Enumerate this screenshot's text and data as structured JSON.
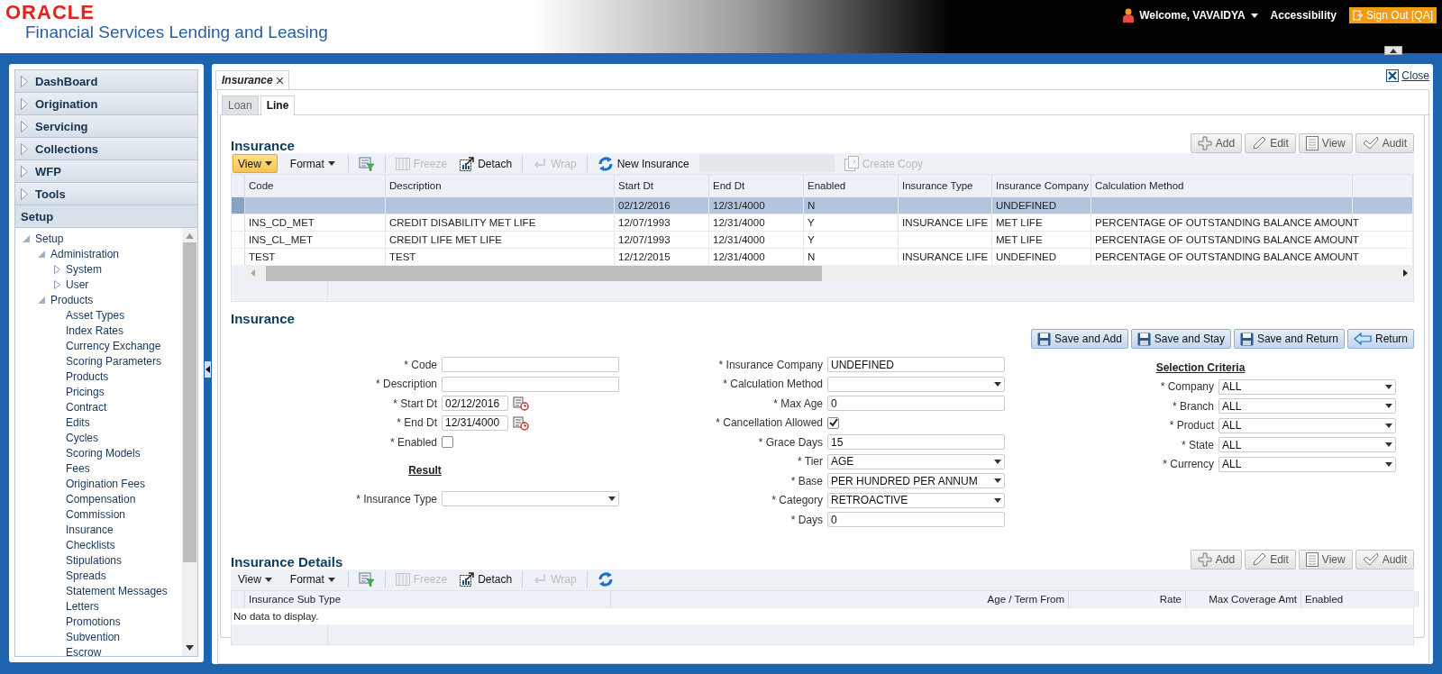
{
  "header": {
    "logo": "ORACLE",
    "product": "Financial Services Lending and Leasing",
    "welcome": "Welcome, VAVAIDYA",
    "accessibility": "Accessibility",
    "sign_out": "Sign Out [QA]"
  },
  "sidebar": {
    "sections": [
      {
        "label": "DashBoard",
        "expanded": false
      },
      {
        "label": "Origination",
        "expanded": false
      },
      {
        "label": "Servicing",
        "expanded": false
      },
      {
        "label": "Collections",
        "expanded": false
      },
      {
        "label": "WFP",
        "expanded": false
      },
      {
        "label": "Tools",
        "expanded": false
      },
      {
        "label": "Setup",
        "expanded": true
      }
    ],
    "tree": [
      {
        "label": "Setup",
        "expanded": true,
        "children": [
          {
            "label": "Administration",
            "expanded": true,
            "children": [
              {
                "label": "System",
                "expanded": false
              },
              {
                "label": "User",
                "expanded": false
              }
            ]
          },
          {
            "label": "Products",
            "expanded": true,
            "children": [
              {
                "label": "Asset Types"
              },
              {
                "label": "Index Rates"
              },
              {
                "label": "Currency Exchange"
              },
              {
                "label": "Scoring Parameters"
              },
              {
                "label": "Products"
              },
              {
                "label": "Pricings"
              },
              {
                "label": "Contract"
              },
              {
                "label": "Edits"
              },
              {
                "label": "Cycles"
              },
              {
                "label": "Scoring Models"
              },
              {
                "label": "Fees"
              },
              {
                "label": "Origination Fees"
              },
              {
                "label": "Compensation"
              },
              {
                "label": "Commission"
              },
              {
                "label": "Insurance"
              },
              {
                "label": "Checklists"
              },
              {
                "label": "Stipulations"
              },
              {
                "label": "Spreads"
              },
              {
                "label": "Statement Messages"
              },
              {
                "label": "Letters"
              },
              {
                "label": "Promotions"
              },
              {
                "label": "Subvention"
              },
              {
                "label": "Escrow"
              }
            ]
          }
        ]
      }
    ]
  },
  "page_tab": {
    "label": "Insurance"
  },
  "close": "Close",
  "subtabs": [
    {
      "label": "Loan",
      "selected": false
    },
    {
      "label": "Line",
      "selected": true
    }
  ],
  "list_section": {
    "title": "Insurance",
    "toolbar": [
      {
        "kind": "menu",
        "label": "View",
        "active": true
      },
      {
        "kind": "menu",
        "label": "Format",
        "active": false
      },
      {
        "kind": "separator"
      },
      {
        "kind": "filter",
        "disabled": false
      },
      {
        "kind": "separator"
      },
      {
        "kind": "freeze",
        "label": "Freeze",
        "disabled": true
      },
      {
        "kind": "detach",
        "label": "Detach",
        "disabled": false
      },
      {
        "kind": "separator"
      },
      {
        "kind": "wrap",
        "label": "Wrap",
        "disabled": true
      },
      {
        "kind": "separator"
      },
      {
        "kind": "refresh",
        "label": "New Insurance",
        "disabled": false
      },
      {
        "kind": "field",
        "disabled": true
      },
      {
        "kind": "copy",
        "label": "Create Copy",
        "disabled": true
      }
    ],
    "actions": [
      {
        "kind": "add",
        "label": "Add",
        "disabled": false
      },
      {
        "kind": "edit",
        "label": "Edit",
        "disabled": false
      },
      {
        "kind": "view",
        "label": "View",
        "disabled": false
      },
      {
        "kind": "audit",
        "label": "Audit",
        "disabled": false
      }
    ],
    "table": {
      "columns": [
        "Code",
        "Description",
        "Start Dt",
        "End Dt",
        "Enabled",
        "Insurance Type",
        "Insurance Company",
        "Calculation Method"
      ],
      "rows": [
        {
          "selected": true,
          "cells": [
            null,
            null,
            "02/12/2016",
            "12/31/4000",
            "N",
            null,
            "UNDEFINED",
            null
          ]
        },
        {
          "selected": false,
          "cells": [
            "INS_CD_MET",
            "CREDIT DISABILITY MET LIFE",
            "12/07/1993",
            "12/31/4000",
            "Y",
            "INSURANCE LIFE",
            "MET LIFE",
            "PERCENTAGE OF OUTSTANDING BALANCE AMOUNT"
          ]
        },
        {
          "selected": false,
          "cells": [
            "INS_CL_MET",
            "CREDIT LIFE MET LIFE",
            "12/07/1993",
            "12/31/4000",
            "Y",
            null,
            "MET LIFE",
            "PERCENTAGE OF OUTSTANDING BALANCE AMOUNT"
          ]
        },
        {
          "selected": false,
          "cells": [
            "TEST",
            "TEST",
            "12/12/2015",
            "12/31/4000",
            "N",
            "INSURANCE LIFE",
            "UNDEFINED",
            "PERCENTAGE OF OUTSTANDING BALANCE AMOUNT"
          ]
        }
      ]
    }
  },
  "form_section": {
    "title": "Insurance",
    "actions": [
      {
        "kind": "save",
        "label": "Save and Add"
      },
      {
        "kind": "save",
        "label": "Save and Stay"
      },
      {
        "kind": "save",
        "label": "Save and Return"
      },
      {
        "kind": "return",
        "label": "Return"
      }
    ],
    "columns": [
      [
        {
          "kind": "text",
          "label": "* Code"
        },
        {
          "kind": "text",
          "label": "* Description"
        },
        {
          "kind": "date",
          "label": "* Start Dt",
          "value": "02/12/2016"
        },
        {
          "kind": "date",
          "label": "* End Dt",
          "value": "12/31/4000"
        },
        {
          "kind": "checkbox",
          "label": "* Enabled",
          "checked": false
        },
        {
          "kind": "heading",
          "label": "Result"
        },
        {
          "kind": "select",
          "label": "* Insurance Type"
        }
      ],
      [
        {
          "kind": "text",
          "label": "* Insurance Company",
          "value": "UNDEFINED"
        },
        {
          "kind": "select",
          "label": "* Calculation Method"
        },
        {
          "kind": "text",
          "label": "* Max Age",
          "value": "0"
        },
        {
          "kind": "checkbox",
          "label": "* Cancellation Allowed",
          "checked": true
        },
        {
          "kind": "text",
          "label": "* Grace Days",
          "value": "15"
        },
        {
          "kind": "select",
          "label": "* Tier",
          "value": "AGE"
        },
        {
          "kind": "select",
          "label": "* Base",
          "value": "PER HUNDRED PER ANNUM"
        },
        {
          "kind": "select",
          "label": "* Category",
          "value": "RETROACTIVE"
        },
        {
          "kind": "text",
          "label": "* Days",
          "value": "0"
        }
      ],
      [
        {
          "kind": "heading",
          "label": "Selection Criteria"
        },
        {
          "kind": "select",
          "label": "* Company",
          "value": "ALL"
        },
        {
          "kind": "select",
          "label": "* Branch",
          "value": "ALL"
        },
        {
          "kind": "select",
          "label": "* Product",
          "value": "ALL"
        },
        {
          "kind": "select",
          "label": "* State",
          "value": "ALL"
        },
        {
          "kind": "select",
          "label": "* Currency",
          "value": "ALL"
        }
      ]
    ]
  },
  "details_section": {
    "title": "Insurance Details",
    "toolbar": [
      {
        "kind": "menu",
        "label": "View",
        "active": false
      },
      {
        "kind": "menu",
        "label": "Format",
        "active": false
      },
      {
        "kind": "separator"
      },
      {
        "kind": "filter",
        "disabled": false
      },
      {
        "kind": "separator"
      },
      {
        "kind": "freeze",
        "label": "Freeze",
        "disabled": true
      },
      {
        "kind": "detach",
        "label": "Detach",
        "disabled": false
      },
      {
        "kind": "separator"
      },
      {
        "kind": "wrap",
        "label": "Wrap",
        "disabled": true
      },
      {
        "kind": "separator"
      },
      {
        "kind": "refresh",
        "disabled": false
      }
    ],
    "actions": [
      {
        "kind": "add",
        "label": "Add",
        "disabled": false
      },
      {
        "kind": "edit",
        "label": "Edit",
        "disabled": false
      },
      {
        "kind": "view",
        "label": "View",
        "disabled": false
      },
      {
        "kind": "audit",
        "label": "Audit",
        "disabled": false
      }
    ],
    "table": {
      "columns": [
        {
          "label": "Insurance Sub Type",
          "kind": "text"
        },
        {
          "label": "Age / Term From",
          "kind": "number"
        },
        {
          "label": "Rate",
          "kind": "number"
        },
        {
          "label": "Max Coverage Amt",
          "kind": "number"
        },
        {
          "label": "Enabled",
          "kind": "text"
        }
      ],
      "empty_text": "No data to display."
    }
  }
}
